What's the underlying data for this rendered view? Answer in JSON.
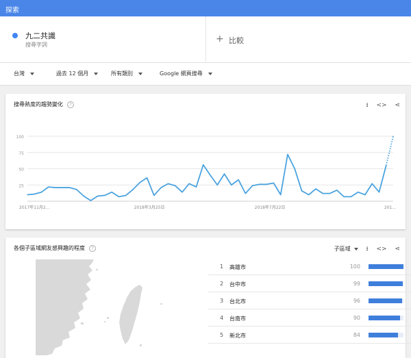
{
  "topbar": {
    "title": "探索"
  },
  "term": {
    "name": "九二共識",
    "sub": "搜尋字詞",
    "color": "#4285f4"
  },
  "compare": {
    "plus": "+",
    "label": "比較"
  },
  "filters": {
    "region": "台灣",
    "period": "過去 12 個月",
    "category": "所有類別",
    "search_type": "Google 網頁搜尋"
  },
  "interest_card": {
    "title": "搜尋熱度的趨勢變化",
    "help": "?",
    "icons": [
      "download-icon",
      "embed-icon",
      "share-icon"
    ],
    "icon_glyphs": {
      "download": "⭳",
      "embed": "<>",
      "share": "⋖"
    }
  },
  "chart_data": {
    "type": "line",
    "y_ticks": [
      "100",
      "75",
      "50",
      "25"
    ],
    "ylim": [
      0,
      100
    ],
    "x_tick_labels": [
      "2017年11月2...",
      "2018年3月25日",
      "2018年7月22日",
      "201..."
    ],
    "x": [
      "2017-11-26",
      "2017-12-03",
      "2017-12-10",
      "2017-12-17",
      "2017-12-24",
      "2017-12-31",
      "2018-01-07",
      "2018-01-14",
      "2018-01-21",
      "2018-01-28",
      "2018-02-04",
      "2018-02-11",
      "2018-02-18",
      "2018-02-25",
      "2018-03-04",
      "2018-03-11",
      "2018-03-18",
      "2018-03-25",
      "2018-04-01",
      "2018-04-08",
      "2018-04-15",
      "2018-04-22",
      "2018-04-29",
      "2018-05-06",
      "2018-05-13",
      "2018-05-20",
      "2018-05-27",
      "2018-06-03",
      "2018-06-10",
      "2018-06-17",
      "2018-06-24",
      "2018-07-01",
      "2018-07-08",
      "2018-07-15",
      "2018-07-22",
      "2018-07-29",
      "2018-08-05",
      "2018-08-12",
      "2018-08-19",
      "2018-08-26",
      "2018-09-02",
      "2018-09-09",
      "2018-09-16",
      "2018-09-23",
      "2018-09-30",
      "2018-10-07",
      "2018-10-14",
      "2018-10-21",
      "2018-10-28",
      "2018-11-04",
      "2018-11-11",
      "2018-11-18",
      "2018-11-25"
    ],
    "series": [
      {
        "color": "#4aa3df",
        "values": [
          10,
          11,
          14,
          22,
          21,
          21,
          21,
          18,
          8,
          1,
          8,
          9,
          14,
          7,
          9,
          18,
          29,
          36,
          9,
          21,
          27,
          24,
          14,
          27,
          22,
          56,
          40,
          25,
          42,
          25,
          33,
          12,
          24,
          26,
          26,
          28,
          10,
          72,
          50,
          16,
          10,
          19,
          12,
          12,
          17,
          7,
          7,
          14,
          10,
          27,
          14,
          55,
          100
        ],
        "dotted_from_index": 51
      }
    ],
    "grid": true
  },
  "region_card": {
    "title": "各個子區域網友感興趣的程度",
    "help": "?",
    "region_type": "子區域",
    "icons": [
      "download-icon",
      "embed-icon",
      "share-icon"
    ],
    "rows": [
      {
        "rank": "1",
        "name": "高雄市",
        "value": "100",
        "score": 100
      },
      {
        "rank": "2",
        "name": "台中市",
        "value": "99",
        "score": 99
      },
      {
        "rank": "3",
        "name": "台北市",
        "value": "96",
        "score": 96
      },
      {
        "rank": "4",
        "name": "台南市",
        "value": "90",
        "score": 90
      },
      {
        "rank": "5",
        "name": "新北市",
        "value": "84",
        "score": 84
      }
    ]
  },
  "colors": {
    "topbar": "#4a86e8",
    "line": "#4aa3df",
    "bar": "#3f7fdc",
    "map_land": "#d9d9d9"
  }
}
